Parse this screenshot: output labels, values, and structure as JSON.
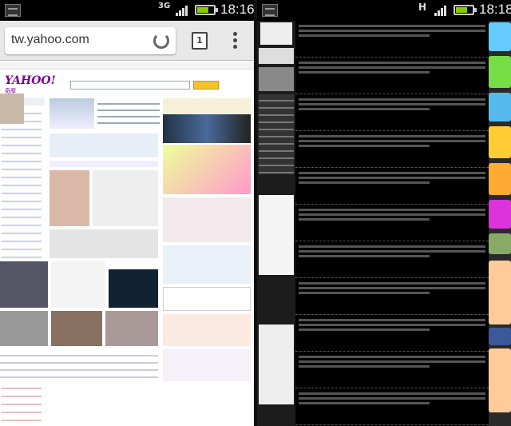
{
  "left_phone": {
    "status": {
      "network": "3G",
      "time": "18:16"
    },
    "browser": {
      "url": "tw.yahoo.com",
      "tab_count": "1"
    },
    "page": {
      "logo": "YAHOO!",
      "logo_sub": "奇摩"
    }
  },
  "right_phone": {
    "status": {
      "network": "H",
      "time": "18:18"
    }
  },
  "colors": {
    "yahoo_purple": "#7b0099",
    "battery_green": "#88cc00",
    "toolbar_gray": "#e8e8e8"
  }
}
